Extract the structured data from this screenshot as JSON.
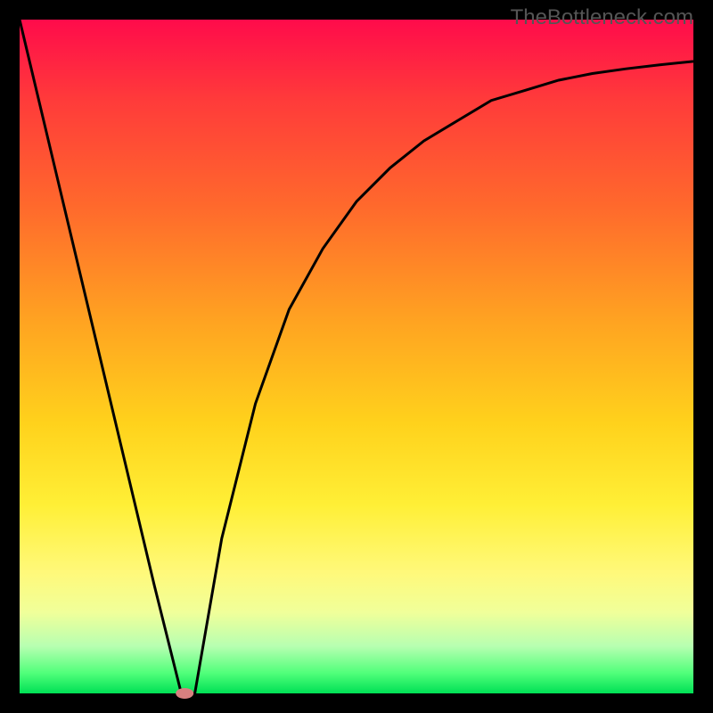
{
  "watermark": "TheBottleneck.com",
  "chart_data": {
    "type": "line",
    "title": "",
    "xlabel": "",
    "ylabel": "",
    "xlim": [
      0,
      100
    ],
    "ylim": [
      0,
      100
    ],
    "series": [
      {
        "name": "curve",
        "x": [
          0,
          5,
          10,
          15,
          20,
          24,
          26,
          30,
          35,
          40,
          45,
          50,
          55,
          60,
          65,
          70,
          75,
          80,
          85,
          90,
          95,
          100
        ],
        "y": [
          100,
          79,
          58,
          37,
          16,
          0,
          0,
          23,
          43,
          57,
          66,
          73,
          78,
          82,
          85,
          88,
          89.5,
          91,
          92,
          92.7,
          93.3,
          93.8
        ]
      }
    ],
    "marker": {
      "x": 24.5,
      "y": 0
    },
    "background_gradient": {
      "orientation": "vertical",
      "stops": [
        {
          "pos": 0,
          "color": "#ff0b4b"
        },
        {
          "pos": 28,
          "color": "#ff6a2c"
        },
        {
          "pos": 60,
          "color": "#ffd21c"
        },
        {
          "pos": 88,
          "color": "#f0ff9a"
        },
        {
          "pos": 100,
          "color": "#00e055"
        }
      ]
    }
  }
}
